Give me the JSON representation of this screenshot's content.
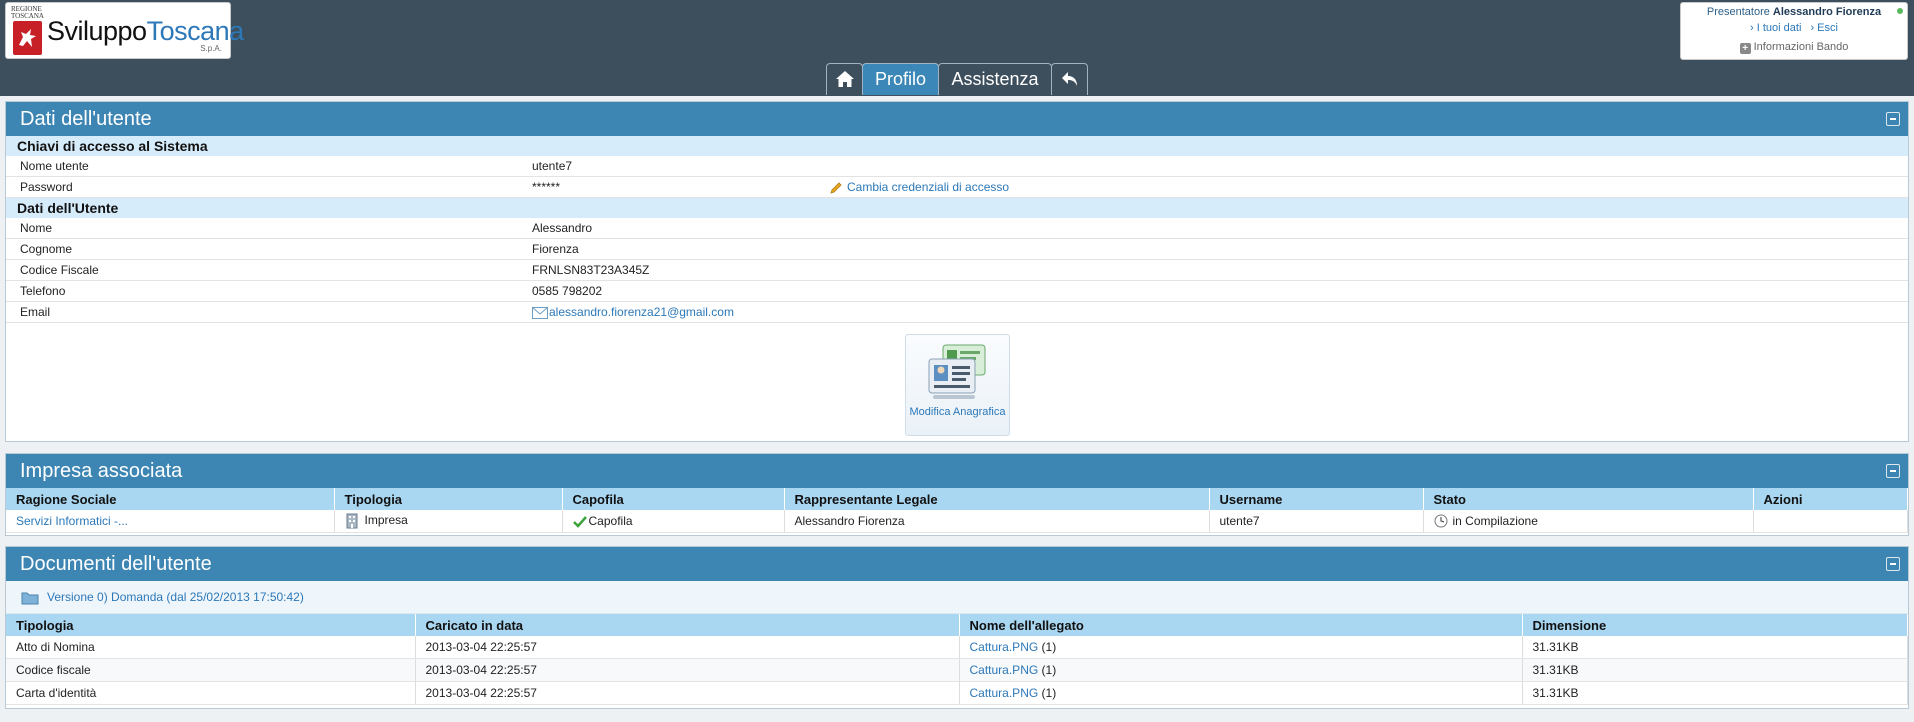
{
  "header": {
    "logo": {
      "region": "REGIONE TOSCANA",
      "brand_a": "Sviluppo",
      "brand_b": "Toscana",
      "suffix": "S.p.A."
    },
    "user": {
      "role": "Presentatore",
      "name": "Alessandro Fiorenza",
      "my_data": "› I tuoi dati",
      "logout": "› Esci",
      "info": "Informazioni Bando"
    },
    "tabs": {
      "profilo": "Profilo",
      "assistenza": "Assistenza"
    }
  },
  "user_panel": {
    "title": "Dati dell'utente",
    "section_access": "Chiavi di accesso al Sistema",
    "section_user": "Dati dell'Utente",
    "rows": {
      "username": {
        "label": "Nome utente",
        "value": "utente7"
      },
      "password": {
        "label": "Password",
        "value": "******",
        "action": "Cambia credenziali di accesso"
      },
      "nome": {
        "label": "Nome",
        "value": "Alessandro"
      },
      "cognome": {
        "label": "Cognome",
        "value": "Fiorenza"
      },
      "cf": {
        "label": "Codice Fiscale",
        "value": "FRNLSN83T23A345Z"
      },
      "tel": {
        "label": "Telefono",
        "value": "0585 798202"
      },
      "email": {
        "label": "Email",
        "value": "alessandro.fiorenza21@gmail.com"
      }
    },
    "edit_button": "Modifica Anagrafica"
  },
  "company_panel": {
    "title": "Impresa associata",
    "columns": [
      "Ragione Sociale",
      "Tipologia",
      "Capofila",
      "Rappresentante Legale",
      "Username",
      "Stato",
      "Azioni"
    ],
    "row": {
      "ragione": "Servizi Informatici -...",
      "tipologia": "Impresa",
      "capofila": "Capofila",
      "rappresentante": "Alessandro Fiorenza",
      "username": "utente7",
      "stato": "in Compilazione",
      "azioni": ""
    }
  },
  "docs_panel": {
    "title": "Documenti dell'utente",
    "version": "Versione 0) Domanda (dal 25/02/2013 17:50:42)",
    "columns": [
      "Tipologia",
      "Caricato in data",
      "Nome dell'allegato",
      "Dimensione"
    ],
    "rows": [
      {
        "tipologia": "Atto di Nomina",
        "data": "2013-03-04 22:25:57",
        "file": "Cattura.PNG",
        "count": " (1)",
        "size": "31.31KB"
      },
      {
        "tipologia": "Codice fiscale",
        "data": "2013-03-04 22:25:57",
        "file": "Cattura.PNG",
        "count": " (1)",
        "size": "31.31KB"
      },
      {
        "tipologia": "Carta d'identità",
        "data": "2013-03-04 22:25:57",
        "file": "Cattura.PNG",
        "count": " (1)",
        "size": "31.31KB"
      }
    ]
  }
}
